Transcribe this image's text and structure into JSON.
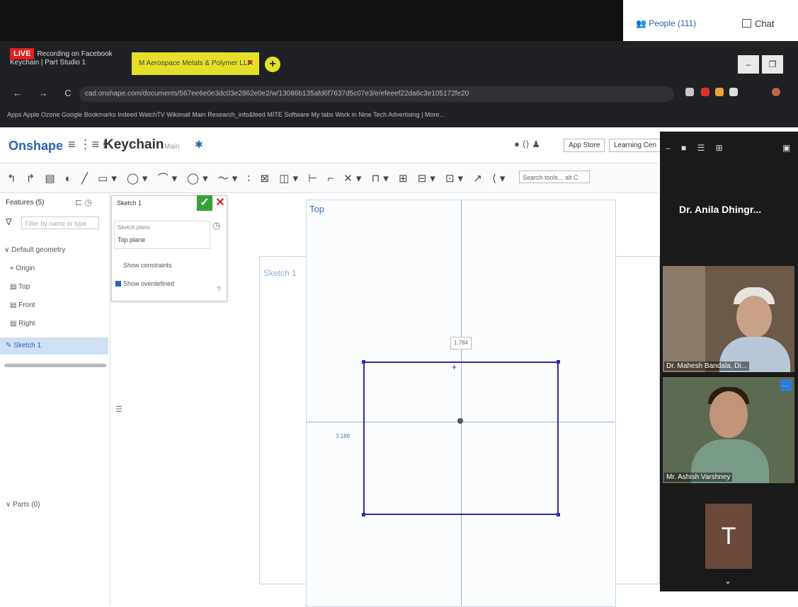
{
  "meeting": {
    "people_label": "People (111)",
    "chat_label": "Chat"
  },
  "browser": {
    "tabs": [
      {
        "line1": "Recording",
        "line2": "Keychain | Part Studio 1",
        "live": "LIVE",
        "extra": "on Facebook"
      },
      {
        "label": "M  Aerospace Metals & Polymer LLP"
      }
    ],
    "new_tab": "+",
    "window_buttons": [
      "–",
      "❐"
    ],
    "nav": "← → C ⌂",
    "url": "cad.onshape.com/documents/567ee6e0e3dc03e2862e0e2/w/13086b135afd6f7637d5c07e3/e/efeeef22da6c3e105172fe20",
    "bookmarks": "Apps   Apple   Ozone   Google   Bookmarks   Indeed WatchTV   Wikimall Main   Research_info&feed   MITE Software   My tabs   Work in Nine Tech   Advertising | More..."
  },
  "onshape": {
    "logo": "Onshape",
    "document": "Keychain",
    "branch": "Main",
    "app_store": "App Store",
    "learning": "Learning Cen",
    "toolbar_glyphs": "↰ ↱ ▤ ◐ ╱ ▭▾ ◯▾ ⌒▾ ◯▾ 〜▾ ∶ ⊠ ◫▾ ⊢ ⌐ ✕▾ ⊓▾ ⊞ ⊟▾ ⊡▾ ↗ ⟨▾",
    "search_placeholder": "Search tools...  alt C"
  },
  "features": {
    "title": "Features (5)",
    "filter_placeholder": "Filter by name or type",
    "default_geometry": "Default geometry",
    "origin": "Origin",
    "top": "Top",
    "front": "Front",
    "right": "Right",
    "sketch": "Sketch 1",
    "parts": "Parts (0)"
  },
  "sketch_dialog": {
    "title": "Sketch 1",
    "plane_label": "Sketch plane",
    "plane_value": "Top plane",
    "show_constraints": "Show constraints",
    "show_overdefined": "Show overdefined"
  },
  "canvas": {
    "plane_name": "Top",
    "sketch_name": "Sketch 1",
    "dim_width": "1.784",
    "dim_height": "3.188"
  },
  "participants": {
    "host": "Dr. Anila Dhingr...",
    "tile1": "Dr. Mahesh Bandala, Di...",
    "tile2": "Mr. Ashish Varshney",
    "avatar_initial": "T"
  },
  "colors": {
    "accent": "#2c60b8",
    "sketch_line": "#2a2ea8",
    "ok_green": "#3a9f3a"
  }
}
